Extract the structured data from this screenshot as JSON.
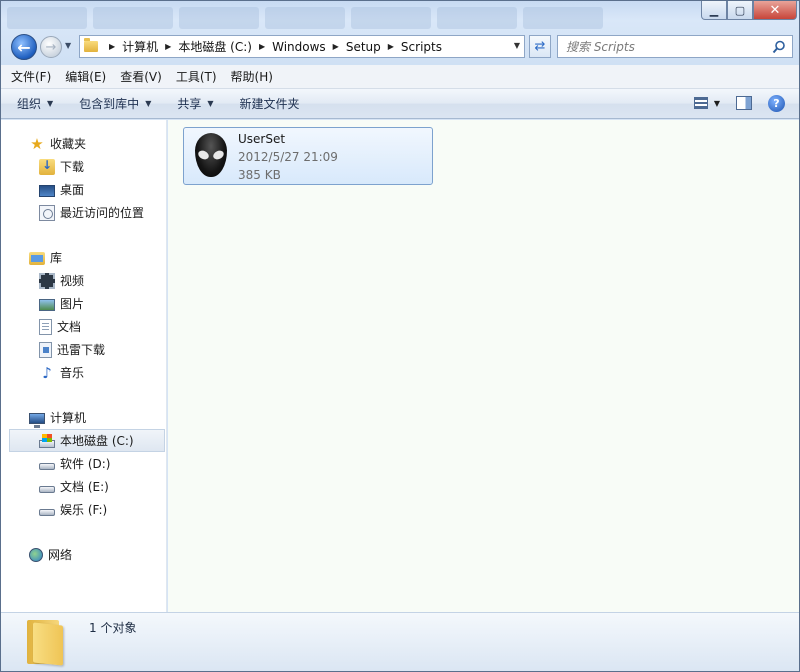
{
  "window": {
    "controls": {
      "minimize": "▁",
      "maximize": "▢",
      "close": "✕"
    }
  },
  "address": {
    "breadcrumbs": [
      "计算机",
      "本地磁盘 (C:)",
      "Windows",
      "Setup",
      "Scripts"
    ]
  },
  "search": {
    "placeholder": "搜索 Scripts"
  },
  "menu": [
    "文件(F)",
    "编辑(E)",
    "查看(V)",
    "工具(T)",
    "帮助(H)"
  ],
  "toolbar": {
    "organize": "组织",
    "include_in_library": "包含到库中",
    "share": "共享",
    "new_folder": "新建文件夹",
    "help": "?"
  },
  "sidebar": {
    "favorites": {
      "label": "收藏夹",
      "items": [
        "下载",
        "桌面",
        "最近访问的位置"
      ]
    },
    "libraries": {
      "label": "库",
      "items": [
        "视频",
        "图片",
        "文档",
        "迅雷下载",
        "音乐"
      ]
    },
    "computer": {
      "label": "计算机",
      "items": [
        "本地磁盘 (C:)",
        "软件 (D:)",
        "文档 (E:)",
        "娱乐 (F:)"
      ],
      "selected": "本地磁盘 (C:)"
    },
    "network": {
      "label": "网络"
    }
  },
  "files": [
    {
      "name": "UserSet",
      "modified": "2012/5/27 21:09",
      "size": "385 KB",
      "icon": "alien-head-icon"
    }
  ],
  "status": {
    "count": "1 个对象"
  },
  "colors": {
    "accent": "#2d68c4",
    "selection_border": "#7da2ce",
    "content_bg": "#f8fcf7"
  }
}
